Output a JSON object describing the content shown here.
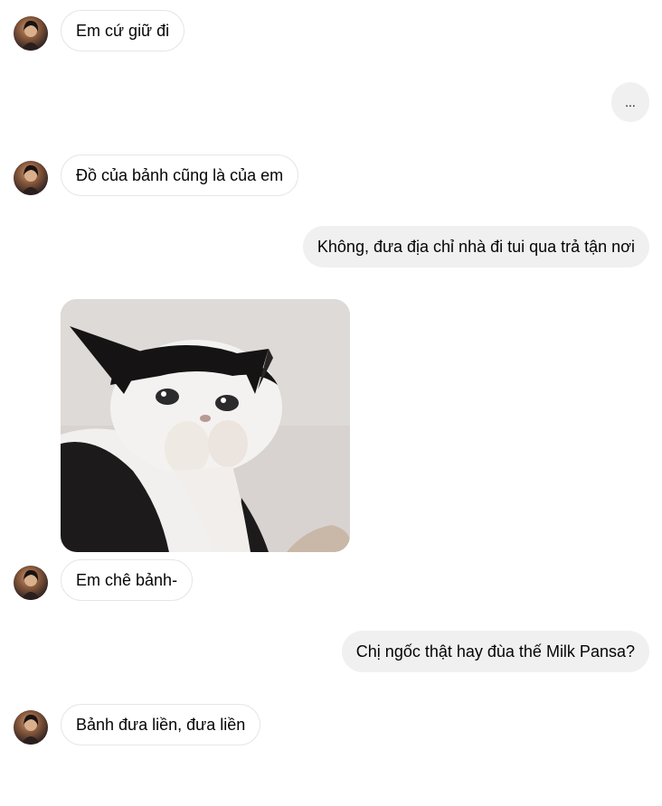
{
  "messages": [
    {
      "text": "Em cứ giữ đi"
    },
    {
      "text": "..."
    },
    {
      "text": "Đồ của bảnh cũng là của em"
    },
    {
      "text": "Không, đưa địa chỉ nhà đi tui qua trả tận nơi"
    },
    {
      "sticker": "crying-cat-covering-mouth"
    },
    {
      "text": "Em chê bảnh-"
    },
    {
      "text": "Chị ngốc thật hay đùa thế Milk Pansa?"
    },
    {
      "text": "Bảnh đưa liền, đưa liền"
    }
  ],
  "colors": {
    "incoming_bubble": "#ffffff",
    "outgoing_bubble": "#f0f0f0",
    "text": "#050505"
  }
}
